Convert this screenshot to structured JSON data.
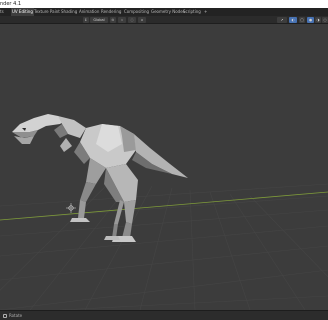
{
  "app": {
    "window_title": "nder 4.1"
  },
  "workspaces": [
    {
      "label": "ts"
    },
    {
      "label": "UV Editing",
      "active": true
    },
    {
      "label": "Texture Paint"
    },
    {
      "label": "Shading"
    },
    {
      "label": "Animation"
    },
    {
      "label": "Rendering"
    },
    {
      "label": "Compositing"
    },
    {
      "label": "Geometry Nodes"
    },
    {
      "label": "Scripting"
    },
    {
      "label": "+"
    }
  ],
  "header": {
    "orientation": "Global"
  },
  "status": {
    "text": "Rotate"
  },
  "colors": {
    "viewport_bg": "#3c3c3c",
    "grid_line": "#454545",
    "x_axis": "#7f9c3a",
    "accent": "#4772b3",
    "model_light": "#c9c9c9",
    "model_dark": "#6b6b6b"
  },
  "icons": [
    "move-icon",
    "gizmo-icon",
    "overlay-icon",
    "shading-solid-icon",
    "origin-icon",
    "snap-icon",
    "proportional-icon"
  ]
}
